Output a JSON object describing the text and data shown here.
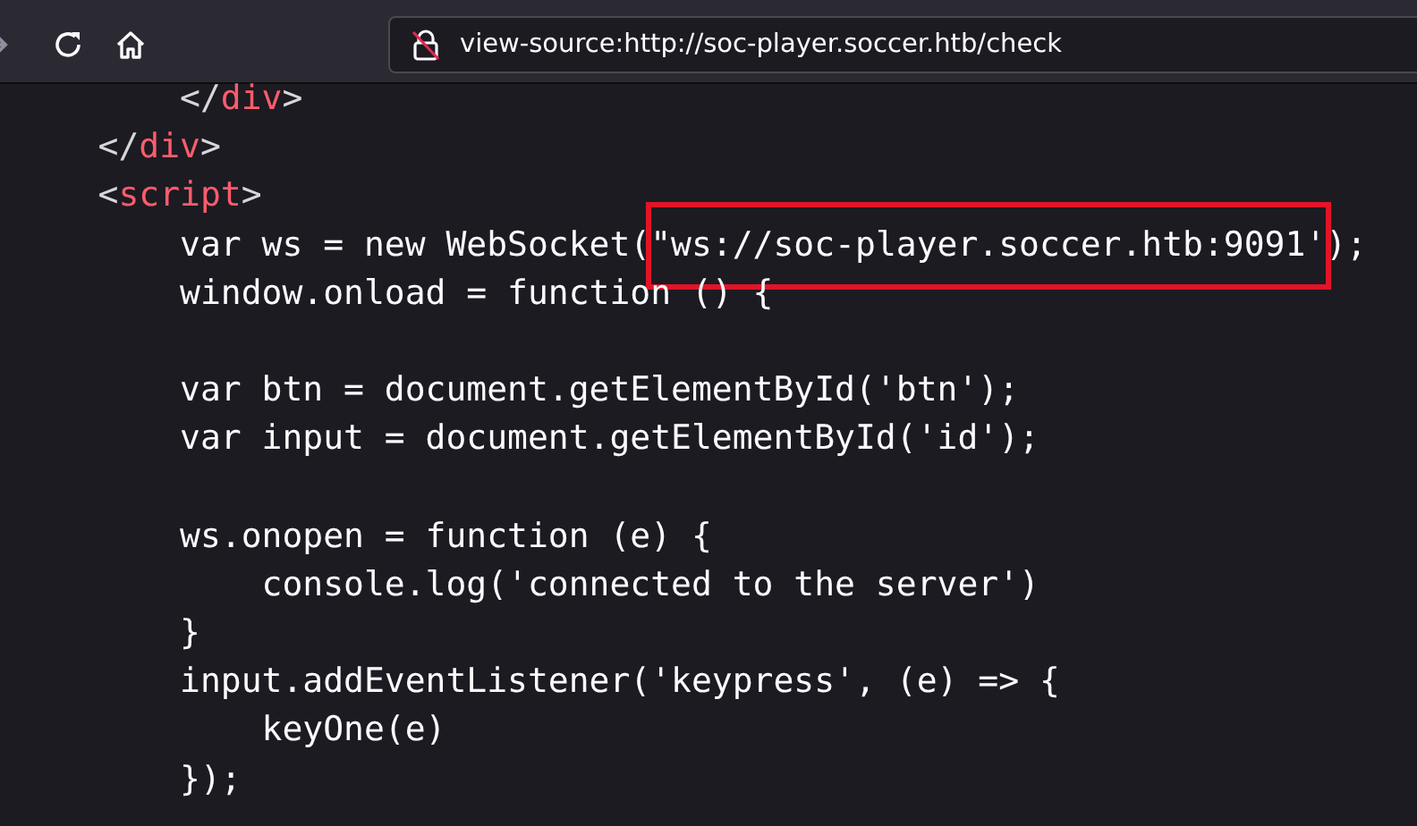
{
  "toolbar": {
    "url": "view-source:http://soc-player.soccer.htb/check"
  },
  "source_lines": [
    {
      "kind": "code",
      "segments": [
        {
          "text": "        </",
          "kind": "punct"
        },
        {
          "text": "div",
          "kind": "tag"
        },
        {
          "text": ">",
          "kind": "punct"
        }
      ]
    },
    {
      "kind": "code",
      "segments": [
        {
          "text": "    </",
          "kind": "punct"
        },
        {
          "text": "div",
          "kind": "tag"
        },
        {
          "text": ">",
          "kind": "punct"
        }
      ]
    },
    {
      "kind": "code",
      "segments": [
        {
          "text": "    <",
          "kind": "punct"
        },
        {
          "text": "script",
          "kind": "tag"
        },
        {
          "text": ">",
          "kind": "punct"
        }
      ]
    },
    {
      "kind": "code",
      "segments": [
        {
          "text": "        var ws = new WebSocket(",
          "kind": "text"
        },
        {
          "text": "\"ws://soc-player.soccer.htb:9091'",
          "kind": "highlighted"
        },
        {
          "text": ");",
          "kind": "text"
        }
      ]
    },
    {
      "kind": "code",
      "segments": [
        {
          "text": "        window.onload = function () {",
          "kind": "text"
        }
      ]
    },
    {
      "kind": "blank"
    },
    {
      "kind": "code",
      "segments": [
        {
          "text": "        var btn = document.getElementById('btn');",
          "kind": "text"
        }
      ]
    },
    {
      "kind": "code",
      "segments": [
        {
          "text": "        var input = document.getElementById('id');",
          "kind": "text"
        }
      ]
    },
    {
      "kind": "blank"
    },
    {
      "kind": "code",
      "segments": [
        {
          "text": "        ws.onopen = function (e) {",
          "kind": "text"
        }
      ]
    },
    {
      "kind": "code",
      "segments": [
        {
          "text": "            console.log('connected to the server')",
          "kind": "text"
        }
      ]
    },
    {
      "kind": "code",
      "segments": [
        {
          "text": "        }",
          "kind": "text"
        }
      ]
    },
    {
      "kind": "code",
      "segments": [
        {
          "text": "        input.addEventListener('keypress', (e) => {",
          "kind": "text"
        }
      ]
    },
    {
      "kind": "code",
      "segments": [
        {
          "text": "            keyOne(e)",
          "kind": "text"
        }
      ]
    },
    {
      "kind": "code",
      "segments": [
        {
          "text": "        });",
          "kind": "text"
        }
      ]
    }
  ]
}
